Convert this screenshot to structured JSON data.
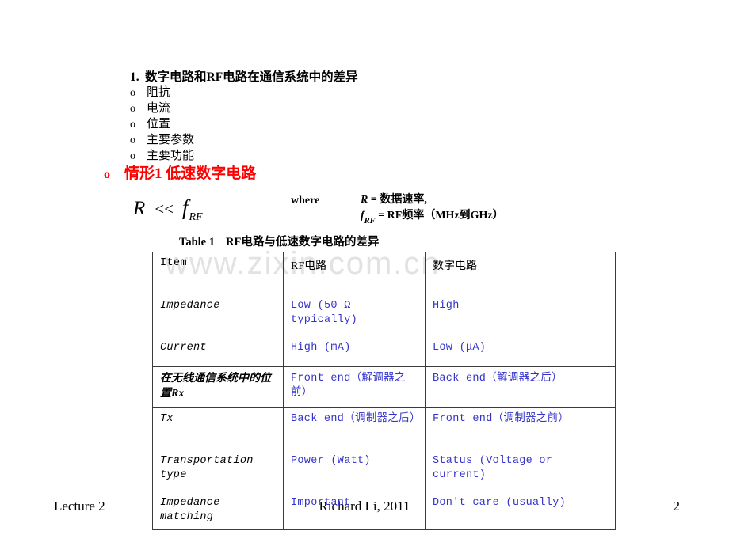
{
  "slide": {
    "outline": {
      "number": "1.",
      "title": "数字电路和RF电路在通信系统中的差异",
      "bullet_glyph": "o",
      "items": [
        "阻抗",
        "电流",
        "位置",
        "主要参数",
        "主要功能"
      ]
    },
    "red_heading": {
      "bullet_glyph": "o",
      "text": "情形1  低速数字电路",
      "color": "#ff0000"
    },
    "formula": {
      "lhs": "R",
      "operator": "<<",
      "rhs_base": "f",
      "rhs_sub": "RF",
      "where_label": "where",
      "definitions": [
        {
          "symbol": "R",
          "symbol_sub": "",
          "text": " = 数据速率,"
        },
        {
          "symbol": "f",
          "symbol_sub": "RF",
          "text": " = RF频率（MHz到GHz）"
        }
      ]
    },
    "table_caption": {
      "label": "Table 1",
      "title": "RF电路与低速数字电路的差异"
    },
    "watermark": "www.zixin.com.cn",
    "table": {
      "headers": [
        "Item",
        "RF电路",
        "数字电路"
      ],
      "rows": [
        {
          "item": "Impedance",
          "item_cjk": false,
          "rf": "Low (50 Ω typically)",
          "digital": "High"
        },
        {
          "item": "Current",
          "item_cjk": false,
          "rf": "High (mA)",
          "digital": "Low  (μA)"
        },
        {
          "item": "在无线通信系统中的位置Rx",
          "item_cjk": true,
          "rf": "Front end（解调器之前）",
          "digital": "Back end（解调器之后）"
        },
        {
          "item": "Tx",
          "item_cjk": false,
          "rf": "Back end（调制器之后）",
          "digital": "Front end（调制器之前）"
        },
        {
          "item": "Transportation type",
          "item_cjk": false,
          "rf": "Power (Watt)",
          "digital": "Status (Voltage or current)"
        },
        {
          "item": "Impedance matching",
          "item_cjk": false,
          "rf": "Important",
          "digital": "Don't care (usually)"
        }
      ],
      "cell_text_color": "#3333cc",
      "border_color": "#3a3a3a"
    },
    "footer": {
      "left": "Lecture 2",
      "center": "Richard Li,  2011",
      "right": "2"
    }
  }
}
